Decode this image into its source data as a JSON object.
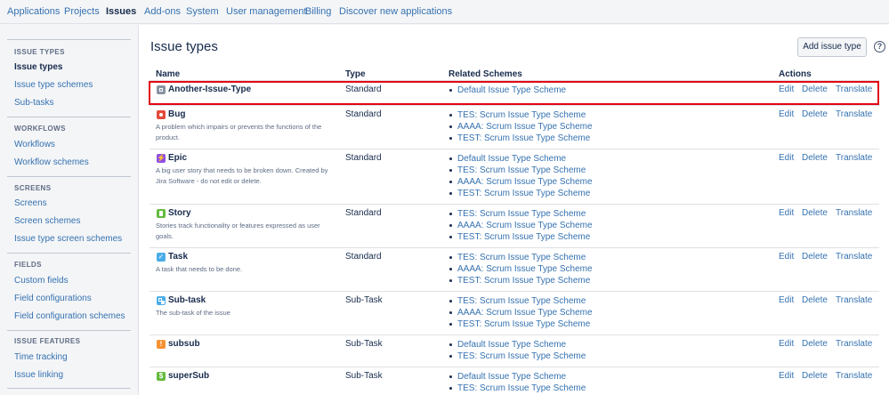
{
  "topnav": {
    "tabs": [
      {
        "label": "Applications"
      },
      {
        "label": "Projects"
      },
      {
        "label": "Issues"
      },
      {
        "label": "Add-ons"
      },
      {
        "label": "System"
      },
      {
        "label": "User management"
      },
      {
        "label": "Billing"
      },
      {
        "label": "Discover new applications"
      }
    ],
    "active": "Issues"
  },
  "sidebar": {
    "sections": [
      {
        "heading": "ISSUE TYPES",
        "items": [
          "Issue types",
          "Issue type schemes",
          "Sub-tasks"
        ]
      },
      {
        "heading": "WORKFLOWS",
        "items": [
          "Workflows",
          "Workflow schemes"
        ]
      },
      {
        "heading": "SCREENS",
        "items": [
          "Screens",
          "Screen schemes",
          "Issue type screen schemes"
        ]
      },
      {
        "heading": "FIELDS",
        "items": [
          "Custom fields",
          "Field configurations",
          "Field configuration schemes"
        ]
      },
      {
        "heading": "ISSUE FEATURES",
        "items": [
          "Time tracking",
          "Issue linking"
        ]
      }
    ],
    "active_item": "Issue types"
  },
  "main": {
    "title": "Issue types",
    "add_button": "Add issue type",
    "help_icon": "?",
    "columns": {
      "name": "Name",
      "type": "Type",
      "schemes": "Related Schemes",
      "actions": "Actions"
    },
    "actions": {
      "edit": "Edit",
      "delete": "Delete",
      "translate": "Translate"
    }
  },
  "issue_types": [
    {
      "name": "Another-Issue-Type",
      "icon": "generic-issue-icon",
      "icon_color": "#8993a4",
      "description": "",
      "type": "Standard",
      "schemes": [
        "Default Issue Type Scheme"
      ]
    },
    {
      "name": "Bug",
      "icon": "bug-icon",
      "icon_color": "#e5493a",
      "description": "A problem which impairs or prevents the functions of the product.",
      "type": "Standard",
      "schemes": [
        "TES: Scrum Issue Type Scheme",
        "AAAA: Scrum Issue Type Scheme",
        "TEST: Scrum Issue Type Scheme"
      ]
    },
    {
      "name": "Epic",
      "icon": "epic-icon",
      "icon_color": "#904ee2",
      "description": "A big user story that needs to be broken down. Created by Jira Software - do not edit or delete.",
      "type": "Standard",
      "schemes": [
        "Default Issue Type Scheme",
        "TES: Scrum Issue Type Scheme",
        "AAAA: Scrum Issue Type Scheme",
        "TEST: Scrum Issue Type Scheme"
      ]
    },
    {
      "name": "Story",
      "icon": "story-icon",
      "icon_color": "#63ba3c",
      "description": "Stories track functionality or features expressed as user goals.",
      "type": "Standard",
      "schemes": [
        "TES: Scrum Issue Type Scheme",
        "AAAA: Scrum Issue Type Scheme",
        "TEST: Scrum Issue Type Scheme"
      ]
    },
    {
      "name": "Task",
      "icon": "task-icon",
      "icon_color": "#4bade8",
      "description": "A task that needs to be done.",
      "type": "Standard",
      "schemes": [
        "TES: Scrum Issue Type Scheme",
        "AAAA: Scrum Issue Type Scheme",
        "TEST: Scrum Issue Type Scheme"
      ]
    },
    {
      "name": "Sub-task",
      "icon": "subtask-icon",
      "icon_color": "#4bade8",
      "description": "The sub-task of the issue",
      "type": "Sub-Task",
      "schemes": [
        "TES: Scrum Issue Type Scheme",
        "AAAA: Scrum Issue Type Scheme",
        "TEST: Scrum Issue Type Scheme"
      ]
    },
    {
      "name": "subsub",
      "icon": "subsub-icon",
      "icon_color": "#f79232",
      "description": "",
      "type": "Sub-Task",
      "schemes": [
        "Default Issue Type Scheme",
        "TES: Scrum Issue Type Scheme"
      ]
    },
    {
      "name": "superSub",
      "icon": "supersub-icon",
      "icon_color": "#63ba3c",
      "description": "",
      "type": "Sub-Task",
      "schemes": [
        "Default Issue Type Scheme",
        "TES: Scrum Issue Type Scheme"
      ]
    }
  ],
  "highlight_color": "#e30613"
}
